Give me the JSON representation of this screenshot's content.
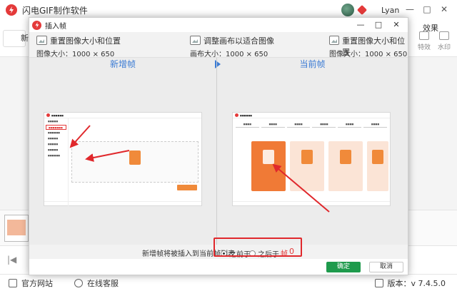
{
  "app": {
    "title": "闪电GIF制作软件",
    "user_name": "Lyan",
    "window_controls": [
      "—",
      "□",
      "✕"
    ],
    "toolbar": {
      "left_label": "新",
      "effects_label": "效果",
      "tools": [
        "特效",
        "水印"
      ]
    },
    "statusbar": {
      "website": "官方网站",
      "support": "在线客服",
      "version": "版本：v 7.4.5.0"
    }
  },
  "dialog": {
    "title": "插入帧",
    "window_controls": [
      "—",
      "□",
      "✕"
    ],
    "options": [
      {
        "label": "重置图像大小和位置",
        "size": "图像大小：1000 × 650"
      },
      {
        "label": "调整画布以适合图像",
        "size": "画布大小：1000 × 650"
      },
      {
        "label": "重置图像大小和位置",
        "size": "图像大小：1000 × 650"
      }
    ],
    "left_panel_title": "新增帧",
    "right_panel_title": "当前帧",
    "insert_label": "新增帧将被插入到当前帧列表",
    "radio_before": "之前于",
    "radio_after": "之后于",
    "frame_word": "帧",
    "frame_number": "0",
    "ok_label": "确定",
    "cancel_label": "取消"
  },
  "colors": {
    "accent_red": "#e43a3a",
    "accent_blue": "#3b7bd4",
    "ok_green": "#1e9a4c",
    "highlight_red": "#e0282c",
    "orange": "#f08a3a"
  }
}
